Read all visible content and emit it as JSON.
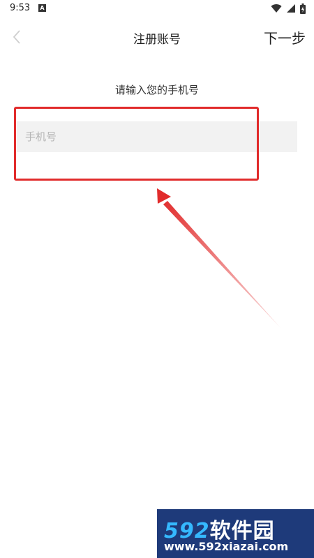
{
  "status_bar": {
    "time": "9:53",
    "icons": [
      "a-notification-icon",
      "wifi-icon",
      "signal-icon",
      "battery-icon"
    ]
  },
  "app_bar": {
    "back_icon": "chevron-left-icon",
    "title": "注册账号",
    "next_label": "下一步"
  },
  "form": {
    "prompt": "请输入您的手机号",
    "phone_placeholder": "手机号",
    "phone_value": ""
  },
  "annotation": {
    "color": "#e12b2b"
  },
  "watermark": {
    "number": "592",
    "name": "软件园",
    "url": "www.592xiazai.com"
  }
}
